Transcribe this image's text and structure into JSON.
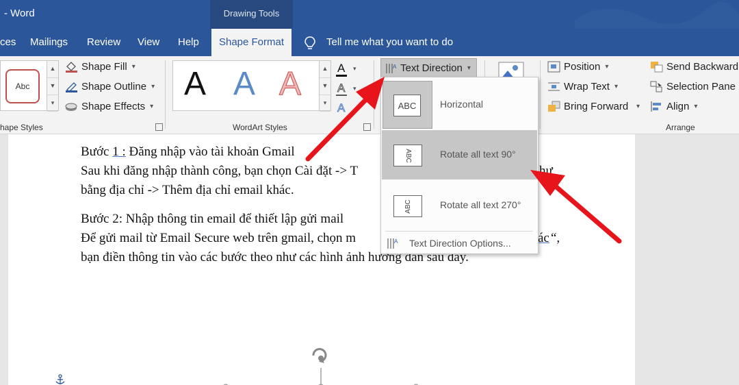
{
  "title_bar": {
    "app_title": "- Word",
    "context_group": "Drawing Tools"
  },
  "tabs": [
    {
      "label": "ces"
    },
    {
      "label": "Mailings"
    },
    {
      "label": "Review"
    },
    {
      "label": "View"
    },
    {
      "label": "Help"
    },
    {
      "label": "Shape Format",
      "active": true
    }
  ],
  "tell_me": {
    "label": "Tell me what you want to do"
  },
  "shape_styles": {
    "sample_label": "Abc",
    "buttons": {
      "fill": "Shape Fill",
      "outline": "Shape Outline",
      "effects": "Shape Effects"
    },
    "group_label": "hape Styles"
  },
  "wordart": {
    "samples": [
      "A",
      "A",
      "A"
    ],
    "group_label": "WordArt Styles"
  },
  "text_group": {
    "text_direction": "Text Direction"
  },
  "arrange": {
    "position": "Position",
    "wrap_text": "Wrap Text",
    "bring_forward": "Bring Forward",
    "send_backward": "Send Backward",
    "selection_pane": "Selection Pane",
    "align": "Align",
    "group_label": "Arrange"
  },
  "dropdown": {
    "items": [
      {
        "label": "Horizontal",
        "thumb": "ABC",
        "state": "selected"
      },
      {
        "label": "Rotate all text 90°",
        "thumb": "ABC",
        "state": "hover"
      },
      {
        "label": "Rotate all text 270°",
        "thumb": "ABC",
        "state": "normal"
      }
    ],
    "options": "Text Direction Options..."
  },
  "document": {
    "lines": [
      {
        "pre": "Bước ",
        "link": "1 :",
        "post": " Đăng nhập vào tài khoản Gmail"
      },
      {
        "text": "Sau khi đăng nhập thành công, bạn chọn Cài đặt -> T"
      },
      {
        "text": "bằng địa chỉ -> Thêm địa chỉ email khác."
      },
      {
        "text": "Bước 2: Nhập thông tin email để thiết lập gửi mail"
      },
      {
        "text": "Để gửi mail từ Email Secure web trên gmail, chọn m"
      },
      {
        "text": "bạn điền thông tin vào các bước theo như các hình ảnh hướng dẫn sau đây."
      }
    ],
    "fragments": {
      "line2_tail": "hư",
      "line5_tail": "ác",
      "line5_quote": "“,"
    }
  },
  "colors": {
    "word_blue": "#2b579a",
    "annotation_red": "#e8141b",
    "selected_gray": "#c6c6c6"
  }
}
